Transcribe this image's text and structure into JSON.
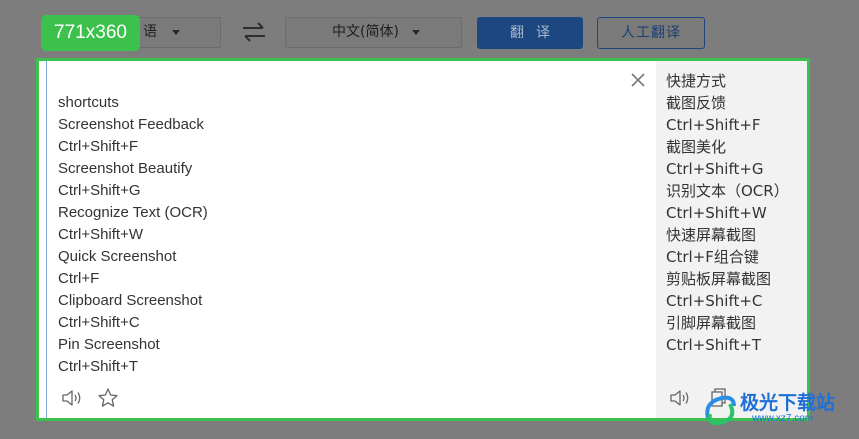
{
  "toolbar": {
    "source_language": "语",
    "target_language": "中文(简体)",
    "translate_label": "翻译",
    "human_translate_label": "人工翻译"
  },
  "annotation": {
    "size_label": "771x360"
  },
  "source": {
    "lines": [
      "shortcuts",
      "Screenshot Feedback",
      "Ctrl+Shift+F",
      "Screenshot Beautify",
      "Ctrl+Shift+G",
      "Recognize Text (OCR)",
      "Ctrl+Shift+W",
      "Quick Screenshot",
      "Ctrl+F",
      "Clipboard Screenshot",
      "Ctrl+Shift+C",
      "Pin Screenshot",
      "Ctrl+Shift+T"
    ]
  },
  "target": {
    "lines": [
      "快捷方式",
      "截图反馈",
      "Ctrl+Shift+F",
      "截图美化",
      "Ctrl+Shift+G",
      "识别文本（OCR）",
      "Ctrl+Shift+W",
      "快速屏幕截图",
      "Ctrl+F组合键",
      "剪贴板屏幕截图",
      "Ctrl+Shift+C",
      "引脚屏幕截图",
      "Ctrl+Shift+T"
    ]
  },
  "watermark": {
    "text": "极光下载站",
    "url": "www.xz7.com"
  },
  "colors": {
    "accent_green": "#3cc24c",
    "button_blue": "#1d4780"
  }
}
